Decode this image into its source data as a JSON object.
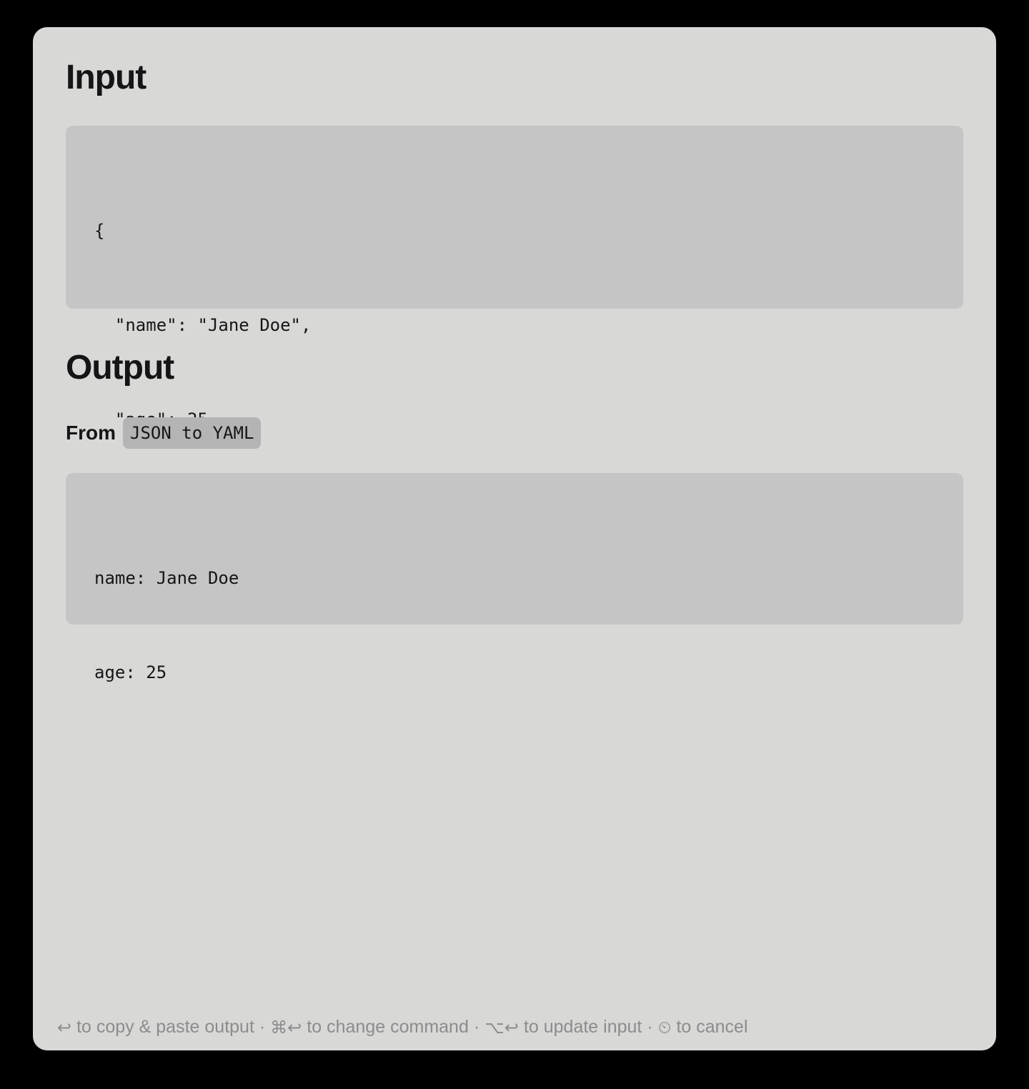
{
  "input": {
    "heading": "Input",
    "lines": [
      "{",
      "  \"name\": \"Jane Doe\",",
      "  \"age\": 25",
      "}"
    ]
  },
  "output": {
    "heading": "Output",
    "from_label": "From",
    "command": "JSON to YAML",
    "lines": [
      "name: Jane Doe",
      "age: 25"
    ]
  },
  "footer": {
    "hints": [
      {
        "icon": "return-icon",
        "glyph": "↩",
        "text": "to copy & paste output"
      },
      {
        "icon": "command-return-icon",
        "glyph": "⌘↩",
        "text": "to change command"
      },
      {
        "icon": "option-return-icon",
        "glyph": "⌥↩",
        "text": "to update input"
      },
      {
        "icon": "cancel-icon",
        "glyph": "⏲",
        "text": "to cancel"
      }
    ],
    "separator": "·"
  }
}
